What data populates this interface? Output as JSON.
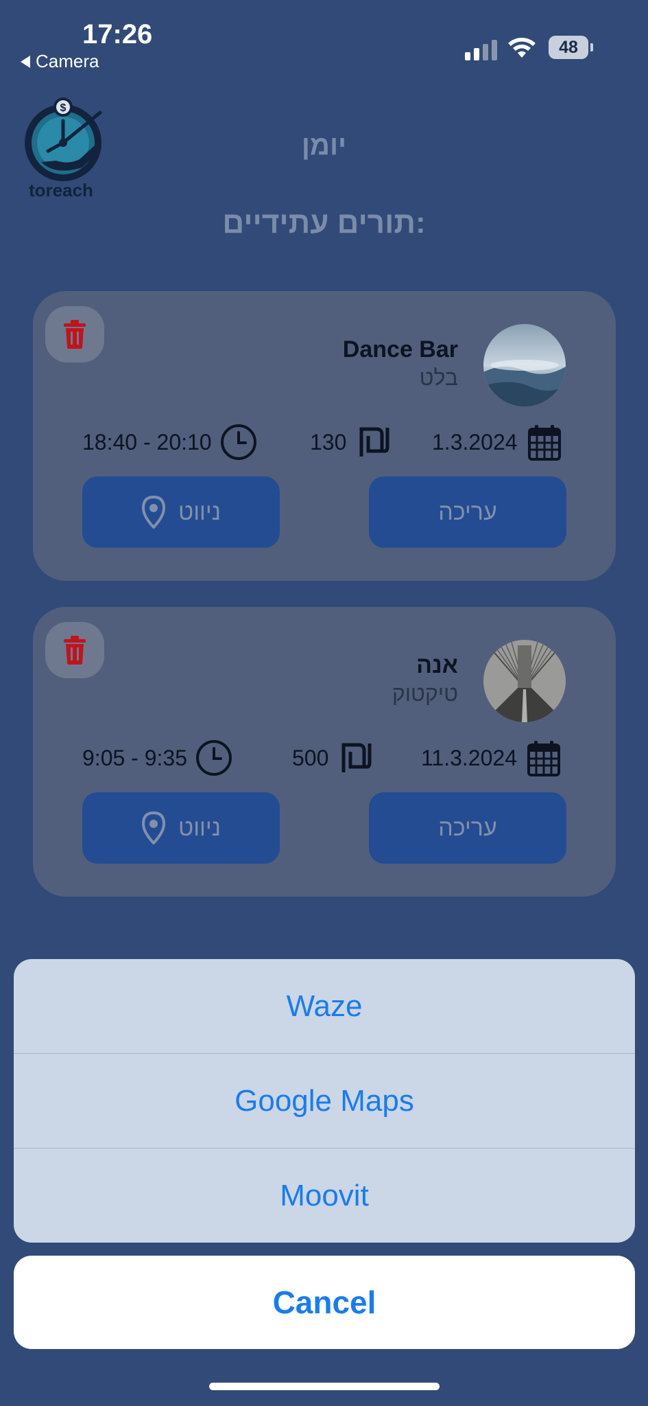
{
  "status_bar": {
    "time": "17:26",
    "back_label": "Camera",
    "battery": "48"
  },
  "header": {
    "logo_text": "toreach",
    "title": "יומן",
    "section_title": "תורים עתידיים:"
  },
  "appointments": [
    {
      "business": "Dance Bar",
      "service": "בלט",
      "date": "1.3.2024",
      "price": "130",
      "time": "18:40 - 20:10",
      "navigate_label": "ניווט",
      "edit_label": "עריכה"
    },
    {
      "business": "אנה",
      "service": "טיקטוק",
      "date": "11.3.2024",
      "price": "500",
      "time": "9:05 - 9:35",
      "navigate_label": "ניווט",
      "edit_label": "עריכה"
    }
  ],
  "action_sheet": {
    "options": [
      "Waze",
      "Google Maps",
      "Moovit"
    ],
    "cancel": "Cancel"
  },
  "colors": {
    "background": "#314a77",
    "card": "#515f7c",
    "button": "#244c92",
    "sheet_text": "#1a7cec",
    "trash": "#c0141c"
  }
}
